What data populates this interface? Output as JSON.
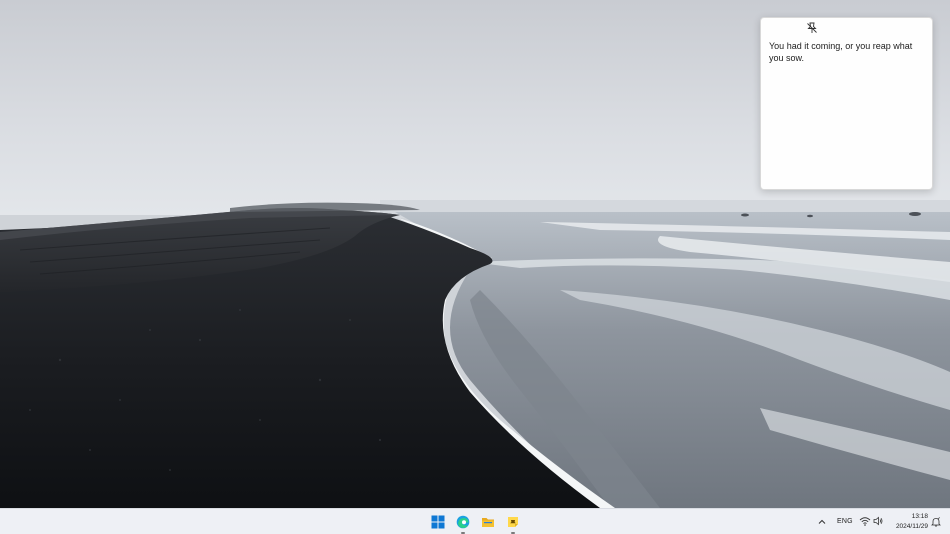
{
  "desktop": {
    "wallpaper": "black-sand-beach-wallpaper"
  },
  "sticky_note": {
    "text": "You had it coming, or you reap what you sow.",
    "pin_icon": "unpin-icon"
  },
  "taskbar": {
    "apps": [
      {
        "name": "Start",
        "icon": "windows-start-icon"
      },
      {
        "name": "Microsoft Edge",
        "icon": "edge-icon"
      },
      {
        "name": "File Explorer",
        "icon": "folder-icon"
      },
      {
        "name": "Sticky Notes",
        "icon": "sticky-notes-icon"
      }
    ],
    "tray": {
      "language": "ENG",
      "time": "13:18",
      "date": "2024/11/29"
    }
  },
  "colors": {
    "taskbar_bg": "#eef0f5",
    "start_blue": "#0f78d4",
    "folder_yellow": "#f4c130",
    "note_yellow": "#ffd84a"
  }
}
